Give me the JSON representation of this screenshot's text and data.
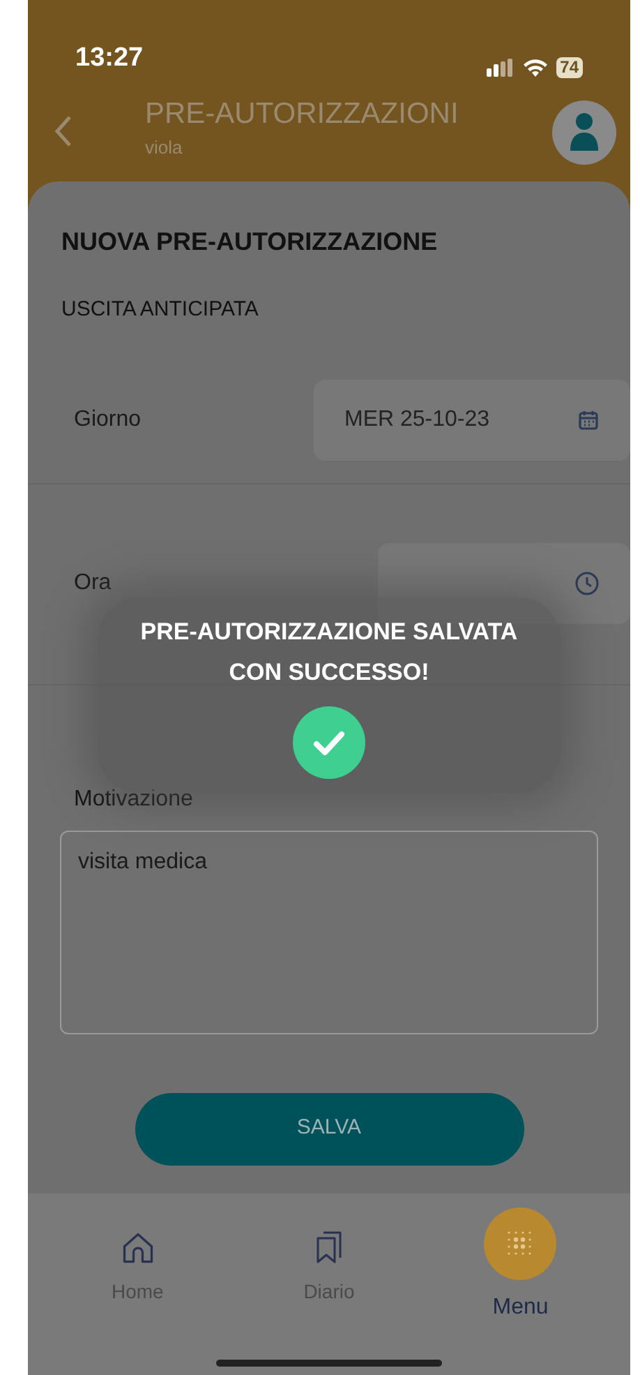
{
  "status_bar": {
    "time": "13:27",
    "battery": "74"
  },
  "header": {
    "title": "PRE-AUTORIZZAZIONI",
    "subtitle": "viola"
  },
  "form": {
    "title": "NUOVA PRE-AUTORIZZAZIONE",
    "type": "USCITA ANTICIPATA",
    "fields": [
      {
        "label": "Giorno",
        "value": "MER 25-10-23",
        "kind": "date"
      },
      {
        "label": "Ora",
        "kind": "time"
      }
    ],
    "reason": {
      "label": "Motivazione",
      "value": "visita medica"
    },
    "save_button": "SALVA"
  },
  "toast": {
    "message": "PRE-AUTORIZZAZIONE SALVATA CON SUCCESSO!"
  },
  "tabs": [
    {
      "label": "Home",
      "kind": "home",
      "selected": false
    },
    {
      "label": "Diario",
      "kind": "diary",
      "selected": false
    },
    {
      "label": "Menu",
      "kind": "menu",
      "selected": true
    }
  ]
}
